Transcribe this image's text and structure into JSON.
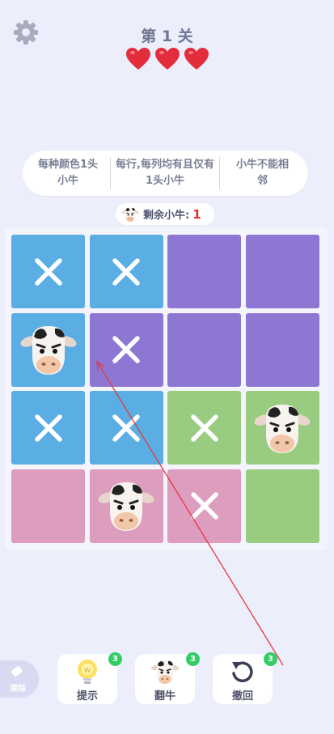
{
  "header": {
    "level_title": "第 1 关",
    "lives": 3
  },
  "rules": [
    "每种颜色1头小牛",
    "每行,每列均有且仅有1头小牛",
    "小牛不能相邻"
  ],
  "status": {
    "remaining_label": "剩余小牛:",
    "remaining_count": "1"
  },
  "colors": {
    "blue": "#5aaee3",
    "purple": "#8d77d3",
    "green": "#99cc80",
    "pink": "#dc9dbf",
    "heart": "#e32d3c",
    "arrow": "#e5393c"
  },
  "grid": [
    [
      {
        "color": "blue",
        "mark": "x"
      },
      {
        "color": "blue",
        "mark": "x"
      },
      {
        "color": "purple",
        "mark": ""
      },
      {
        "color": "purple",
        "mark": ""
      }
    ],
    [
      {
        "color": "blue",
        "mark": "cow"
      },
      {
        "color": "purple",
        "mark": "x"
      },
      {
        "color": "purple",
        "mark": ""
      },
      {
        "color": "purple",
        "mark": ""
      }
    ],
    [
      {
        "color": "blue",
        "mark": "x"
      },
      {
        "color": "blue",
        "mark": "x"
      },
      {
        "color": "green",
        "mark": "x"
      },
      {
        "color": "green",
        "mark": "cow"
      }
    ],
    [
      {
        "color": "pink",
        "mark": ""
      },
      {
        "color": "pink",
        "mark": "cow"
      },
      {
        "color": "pink",
        "mark": "x"
      },
      {
        "color": "green",
        "mark": ""
      }
    ]
  ],
  "tools": {
    "eraser_label": "清除",
    "hint": {
      "label": "提示",
      "count": "3"
    },
    "flip": {
      "label": "翻牛",
      "count": "3"
    },
    "undo": {
      "label": "撤回",
      "count": "3"
    }
  }
}
